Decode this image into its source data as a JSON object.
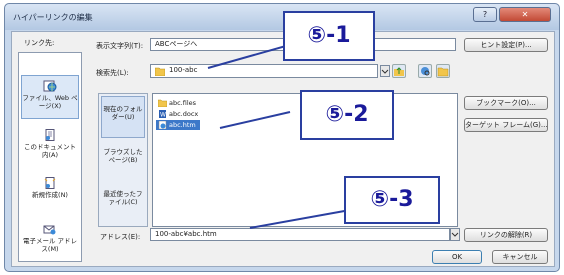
{
  "window": {
    "title": "ハイパーリンクの編集",
    "help_btn": "?",
    "close_btn": "✕"
  },
  "link_to": {
    "label": "リンク先:",
    "items": [
      {
        "label": "ファイル、Web ページ(X)",
        "icon": "web-page-icon"
      },
      {
        "label": "このドキュメント内(A)",
        "icon": "document-icon"
      },
      {
        "label": "新規作成(N)",
        "icon": "new-document-icon"
      },
      {
        "label": "電子メール アドレス(M)",
        "icon": "email-icon"
      }
    ]
  },
  "display_text": {
    "label": "表示文字列(T):",
    "value": "ABCページへ",
    "tip_button": "ヒント設定(P)..."
  },
  "look_in": {
    "label": "検索先(L):",
    "value": "100-abc"
  },
  "look_buttons": [
    {
      "label": "現在のフォルダー(U)"
    },
    {
      "label": "ブラウズしたページ(B)"
    },
    {
      "label": "最近使ったファイル(C)"
    }
  ],
  "files": [
    {
      "name": "abc.files",
      "type": "folder"
    },
    {
      "name": "abc.docx",
      "type": "word"
    },
    {
      "name": "abc.htm",
      "type": "html"
    }
  ],
  "side_buttons": {
    "bookmark": "ブックマーク(O)...",
    "target_frame": "ターゲット フレーム(G)..."
  },
  "address": {
    "label": "アドレス(E):",
    "value": "100-abc¥abc.htm",
    "remove_link": "リンクの解除(R)"
  },
  "footer": {
    "ok": "OK",
    "cancel": "キャンセル"
  },
  "callouts": {
    "c1": "⑤-1",
    "c2": "⑤-2",
    "c3": "⑤-3"
  },
  "colors": {
    "callout_border": "#2a3fa0",
    "selection": "#3c78c9"
  }
}
